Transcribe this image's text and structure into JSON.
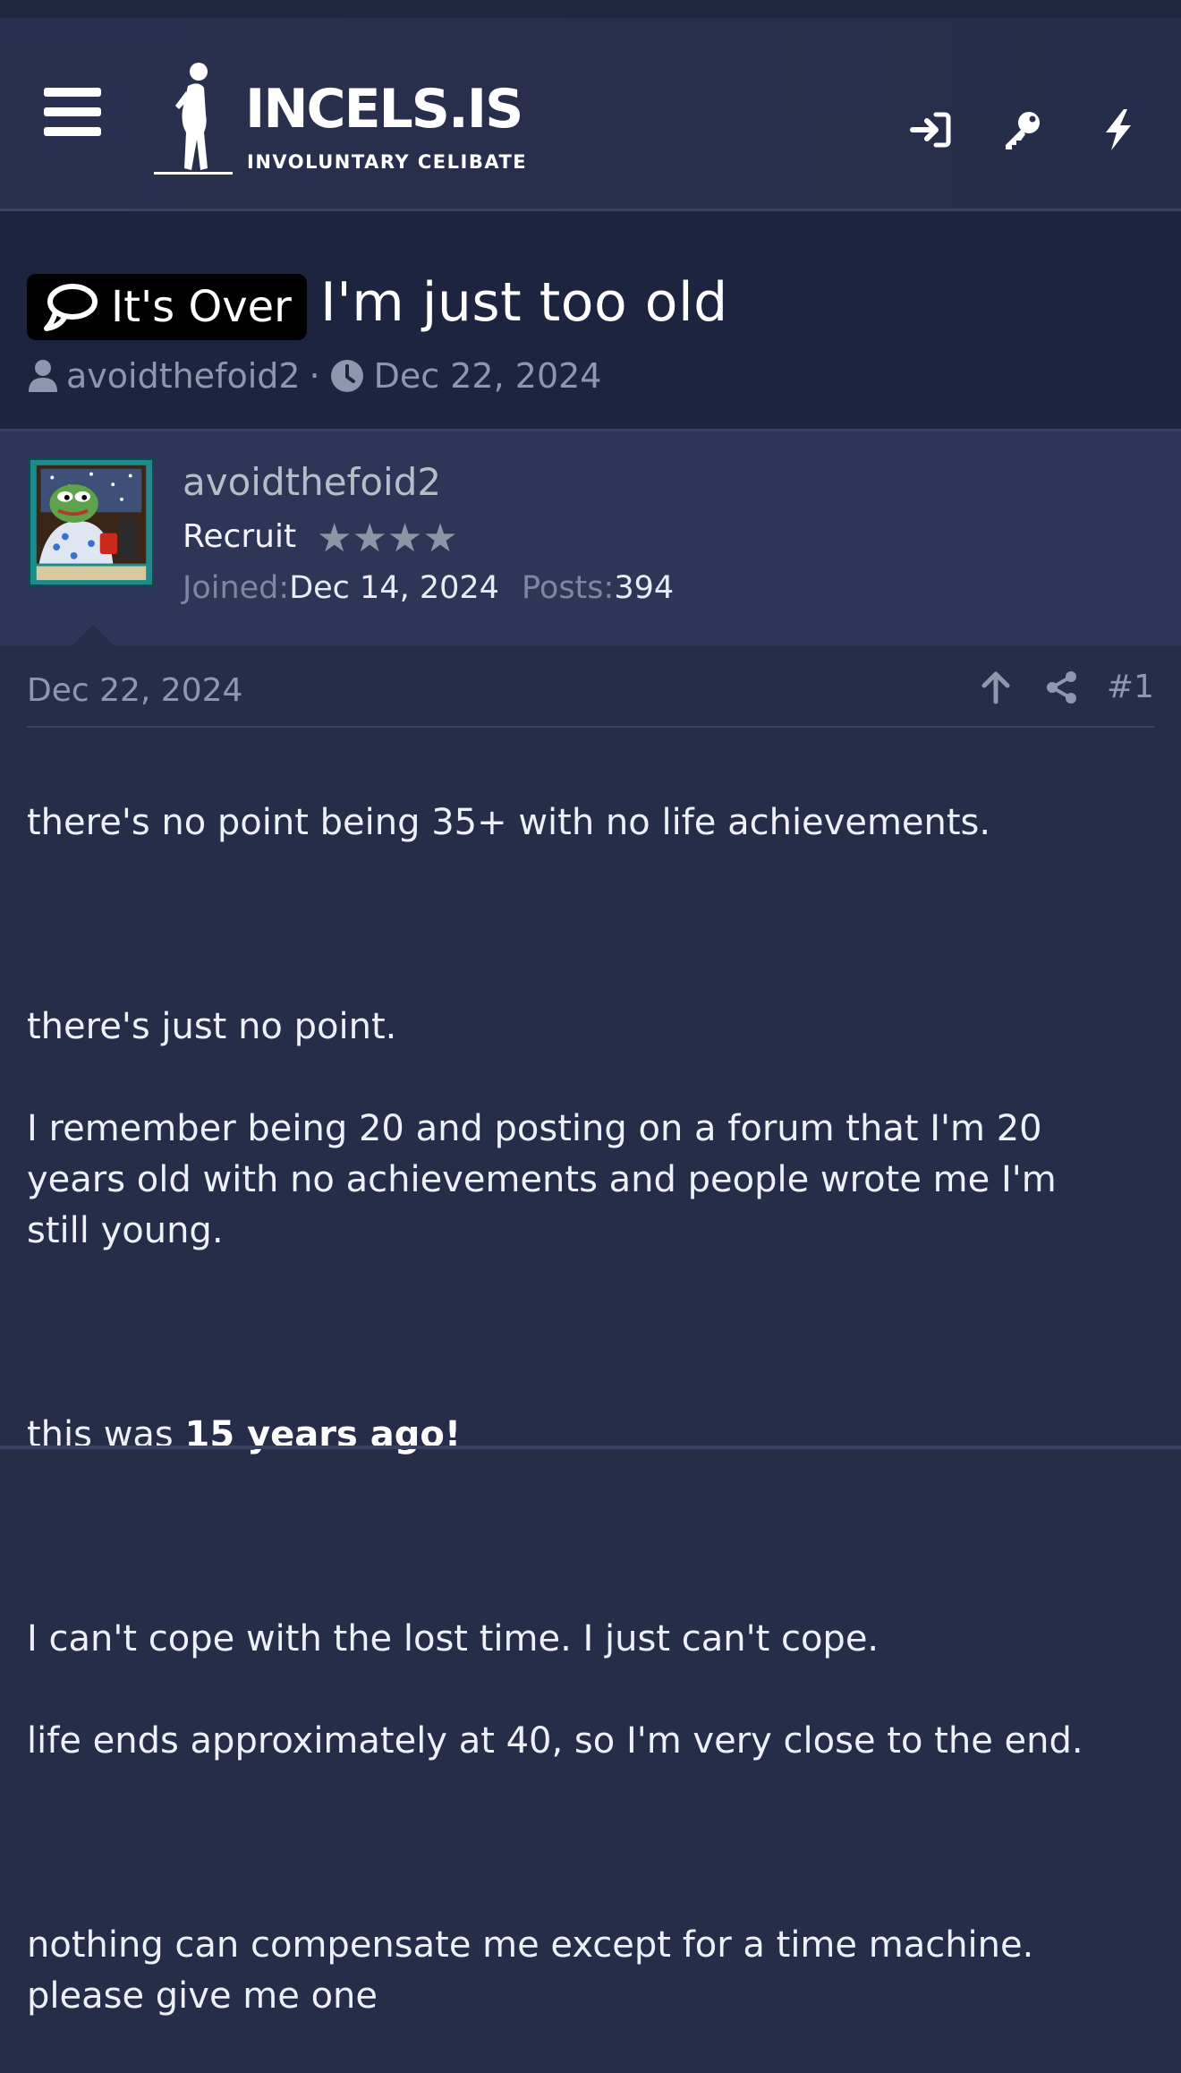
{
  "header": {
    "logo_title": "INCELS.IS",
    "logo_subtitle": "INVOLUNTARY CELIBATE",
    "menu_icon": "hamburger-icon",
    "icons": [
      "login-arrow-icon",
      "key-icon",
      "lightning-bolt-icon"
    ]
  },
  "thread": {
    "prefix": "It's Over",
    "prefix_icon": "speech-bubble-icon",
    "title": "I'm just too old",
    "author": "avoidthefoid2",
    "separator": "·",
    "date": "Dec 22, 2024"
  },
  "user": {
    "name": "avoidthefoid2",
    "title": "Recruit",
    "stars": "★★★★",
    "joined_label": "Joined:",
    "joined": "Dec 14, 2024",
    "posts_label": "Posts:",
    "posts": "394",
    "avatar": "pepe-card-avatar"
  },
  "post": {
    "date": "Dec 22, 2024",
    "number": "#1",
    "line1": "there's no point being 35+ with no life achievements.",
    "line2": "there's just no point.",
    "line3": "I remember being 20 and posting on a forum that I'm 20 years old with no achievements and people wrote me I'm still young.",
    "line4_prefix": "this was ",
    "line4_bold": "15 years ago!",
    "line5": "I can't cope with the lost time. I just can't cope.",
    "line6": "life ends approximately at 40, so I'm very close to the end.",
    "line7": "nothing can compensate me except for a time machine. please give me one"
  },
  "colors": {
    "background": "#262d48",
    "header": "#2a3150",
    "title_area": "#1d2440",
    "user_block": "#2e3657",
    "muted_text": "#8f97ae",
    "prefix_bg": "#000000"
  }
}
